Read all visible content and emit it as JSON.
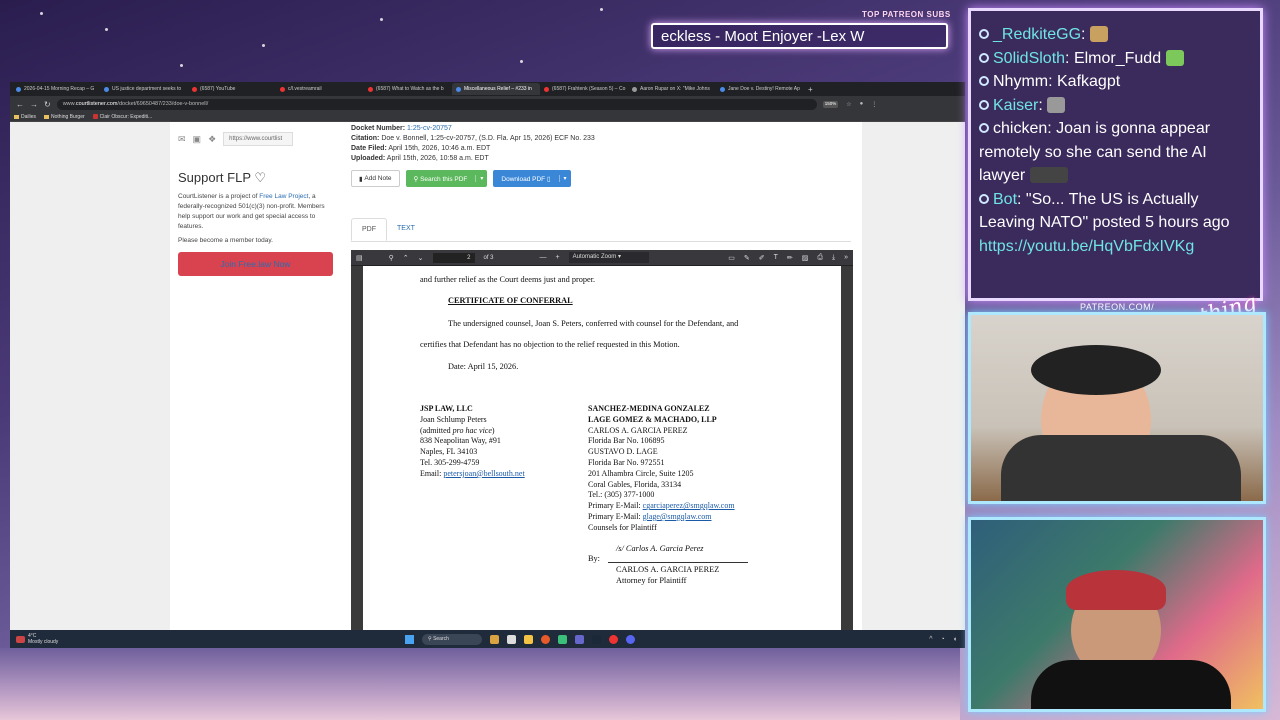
{
  "overlay": {
    "top_label": "TOP PATREON SUBS",
    "ticker": "eckless - Moot Enjoyer -Lex W",
    "patreon_label": "PATREON.COM/",
    "brand": "Anything Else?"
  },
  "browser": {
    "tabs": [
      {
        "label": "2026-04-15 Morning Recap – G",
        "icon": "doc"
      },
      {
        "label": "US justice department seeks to",
        "icon": "doc"
      },
      {
        "label": "(6587) YouTube",
        "icon": "youtube"
      },
      {
        "label": "c/l.vestreamrail",
        "icon": "youtube"
      },
      {
        "label": "(6587) What to Watch as the b",
        "icon": "youtube"
      },
      {
        "label": "Miscellaneous Relief – #233 in",
        "icon": "courtlistener",
        "active": true
      },
      {
        "label": "(6587) Frahtenk (Season 5) – Co",
        "icon": "youtube"
      },
      {
        "label": "Aaron Rupar on X: \"Mike Johns",
        "icon": "x"
      },
      {
        "label": "Jane Doe v. Destiny! Remote Ap",
        "icon": "doc"
      }
    ],
    "url_prefix": "www.",
    "url_host": "courtlistener.com",
    "url_path": "/docket/69650487/233/doe-v-bonnell/",
    "zoom": "150%",
    "bookmarks": [
      "Dailies",
      "Nothing Burger",
      "Clair Obscur: Expediti..."
    ]
  },
  "sidebar": {
    "social_url": "https://www.courtlist",
    "support_title": "Support FLP",
    "support_text_1a": "CourtListener is a project of ",
    "support_link": "Free Law Project",
    "support_text_1b": ", a federally-recognized 501(c)(3) non-profit. Members help support our work and get special access to features.",
    "support_text_2": "Please become a member today.",
    "join_button": "Join Free.law Now"
  },
  "docket": {
    "number_label": "Docket Number:",
    "number": "1:25-cv-20757",
    "citation_label": "Citation:",
    "citation": "Doe v. Bonnell, 1:25-cv-20757, (S.D. Fla. Apr 15, 2026) ECF No. 233",
    "filed_label": "Date Filed:",
    "filed": "April 15th, 2026, 10:46 a.m. EDT",
    "uploaded_label": "Uploaded:",
    "uploaded": "April 15th, 2026, 10:58 a.m. EDT"
  },
  "actions": {
    "add_note": "Add Note",
    "search_pdf": "Search this PDF",
    "download_pdf": "Download PDF"
  },
  "view_tabs": {
    "pdf": "PDF",
    "text": "TEXT"
  },
  "pdf_viewer": {
    "page": "2",
    "page_total": "of 3",
    "zoom": "Automatic Zoom"
  },
  "document": {
    "line0": "and further relief as the Court deems just and proper.",
    "heading": "CERTIFICATE OF CONFERRAL",
    "para1": "The undersigned counsel, Joan S. Peters, conferred with counsel for the Defendant, and",
    "para2": "certifies that Defendant has no objection to the relief requested in this Motion.",
    "date": "Date: April 15, 2026.",
    "left": {
      "firm": "JSP LAW, LLC",
      "name": "Joan Schlump Peters",
      "admit_a": "(admitted ",
      "admit_i": "pro hac vice",
      "admit_b": ")",
      "addr1": "838 Neapolitan Way, #91",
      "addr2": "Naples, FL 34103",
      "tel": "Tel. 305-299-4759",
      "email_label": "Email: ",
      "email": "petersjoan@bellsouth.net"
    },
    "right": {
      "firm1": "SANCHEZ-MEDINA GONZALEZ",
      "firm2": "LAGE GOMEZ & MACHADO, LLP",
      "n1": "CARLOS A. GARCIA PEREZ",
      "bar1": "Florida Bar No. 106895",
      "n2": "GUSTAVO D. LAGE",
      "bar2": "Florida Bar No.  972551",
      "addr1": "201 Alhambra Circle, Suite 1205",
      "addr2": "Coral Gables, Florida, 33134",
      "tel": "Tel.: (305) 377-1000",
      "email_label": "Primary E-Mail: ",
      "email1": "cgarciaperez@smgqlaw.com",
      "email2": "glage@smgqlaw.com",
      "counsel": "Counsels for Plaintiff",
      "sig": "/s/ Carlos A. Garcia Perez",
      "by": "By:",
      "sig_name": "CARLOS A. GARCIA PEREZ",
      "role": "Attorney for Plaintiff"
    }
  },
  "taskbar": {
    "temp": "4°C",
    "weather": "Mostly cloudy",
    "search": "Search"
  },
  "chat": [
    {
      "user": "_RedkiteGG",
      "sep": ":",
      "text": " ",
      "color": "#6fe4e4",
      "emote": "#c8a060"
    },
    {
      "user": "S0lidSloth",
      "sep": ":",
      "text": " Elmor_Fudd ",
      "color": "#6fe4e4",
      "emote": "#7cc85a"
    },
    {
      "user": "Nhymm",
      "sep": ":",
      "text": " Kafkagpt",
      "color": "#ffffff"
    },
    {
      "user": "Kaiser",
      "sep": ":",
      "text": " ",
      "color": "#6fe4e4",
      "emote": "#999999"
    },
    {
      "user": "chicken",
      "sep": ":",
      "text": " Joan is gonna appear remotely so she can send the AI lawyer ",
      "color": "#ffffff",
      "emote": "#444444"
    },
    {
      "user": "Bot",
      "sep": ":",
      "text": " \"So... The US is Actually Leaving NATO\" posted 5 hours ago",
      "color": "#6fe4e4"
    }
  ],
  "chat_link": "https://youtu.be/HqVbFdxIVKg"
}
